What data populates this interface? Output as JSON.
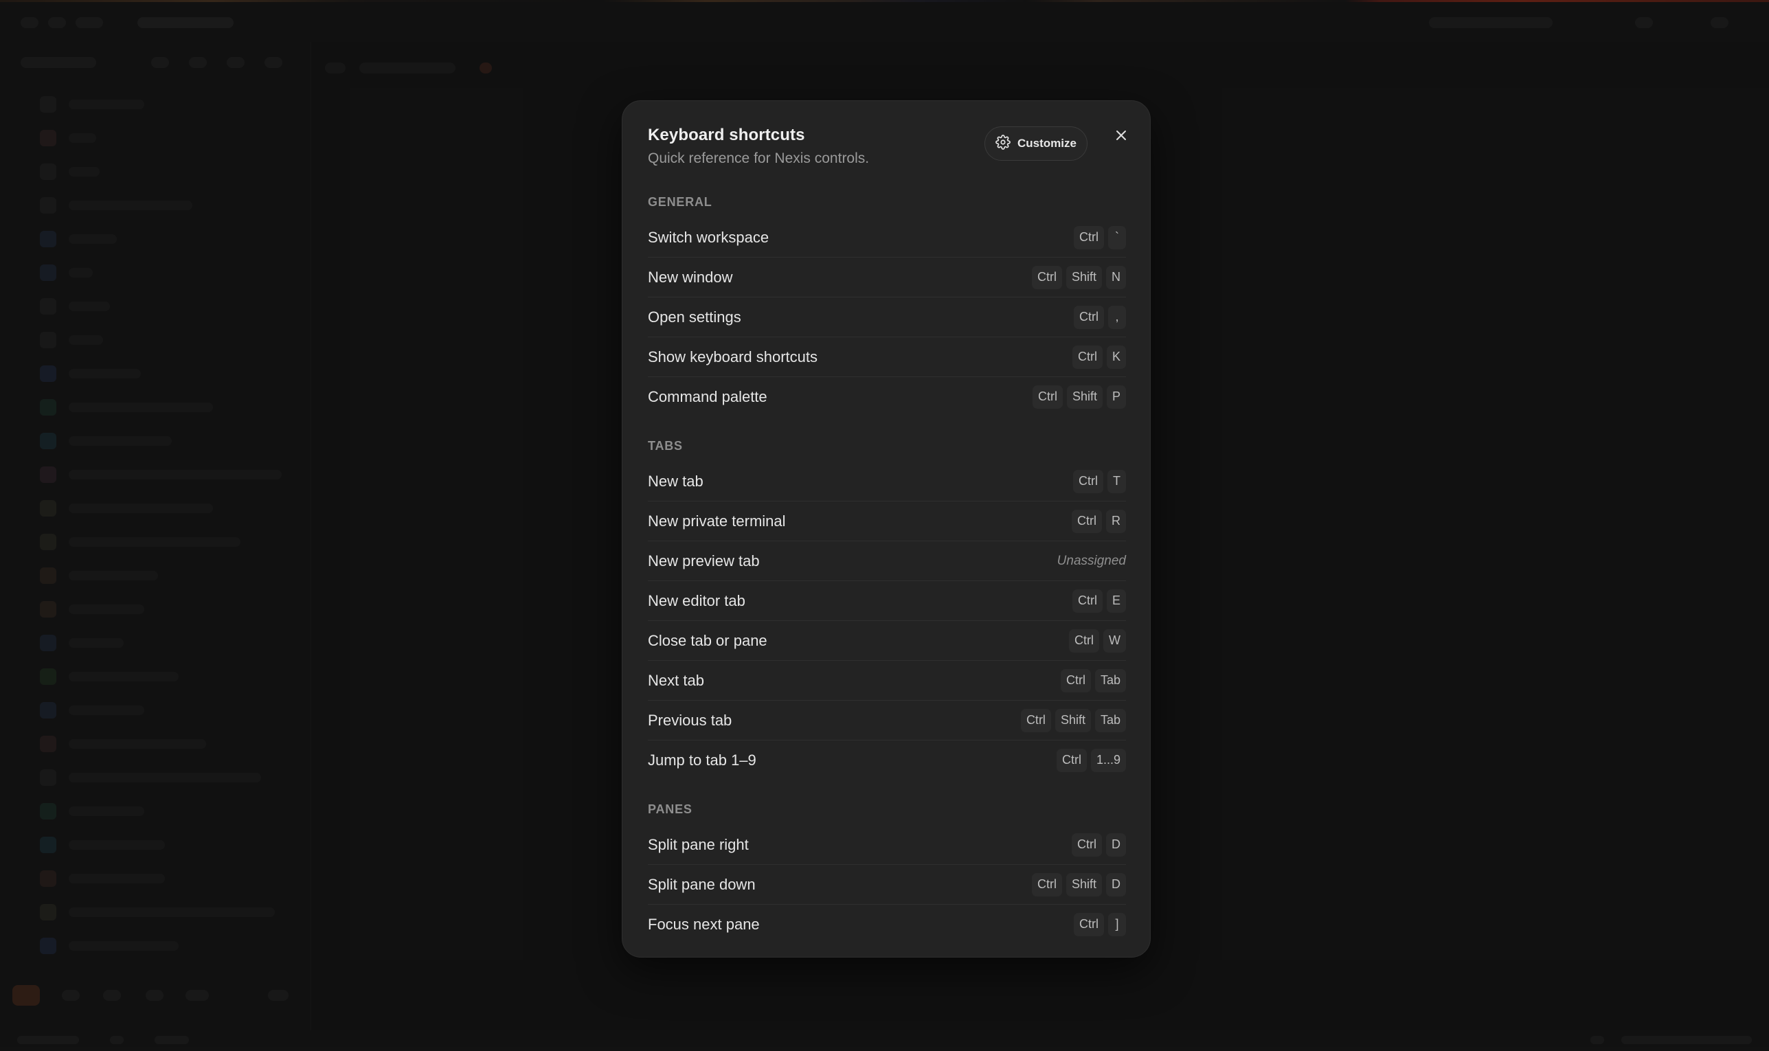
{
  "modal": {
    "title": "Keyboard shortcuts",
    "subtitle": "Quick reference for Nexis controls.",
    "customize_label": "Customize",
    "sections": [
      {
        "heading": "GENERAL",
        "rows": [
          {
            "label": "Switch workspace",
            "keys": [
              "Ctrl",
              "`"
            ]
          },
          {
            "label": "New window",
            "keys": [
              "Ctrl",
              "Shift",
              "N"
            ]
          },
          {
            "label": "Open settings",
            "keys": [
              "Ctrl",
              ","
            ]
          },
          {
            "label": "Show keyboard shortcuts",
            "keys": [
              "Ctrl",
              "K"
            ]
          },
          {
            "label": "Command palette",
            "keys": [
              "Ctrl",
              "Shift",
              "P"
            ]
          }
        ]
      },
      {
        "heading": "TABS",
        "rows": [
          {
            "label": "New tab",
            "keys": [
              "Ctrl",
              "T"
            ]
          },
          {
            "label": "New private terminal",
            "keys": [
              "Ctrl",
              "R"
            ]
          },
          {
            "label": "New preview tab",
            "unassigned": "Unassigned"
          },
          {
            "label": "New editor tab",
            "keys": [
              "Ctrl",
              "E"
            ]
          },
          {
            "label": "Close tab or pane",
            "keys": [
              "Ctrl",
              "W"
            ]
          },
          {
            "label": "Next tab",
            "keys": [
              "Ctrl",
              "Tab"
            ]
          },
          {
            "label": "Previous tab",
            "keys": [
              "Ctrl",
              "Shift",
              "Tab"
            ]
          },
          {
            "label": "Jump to tab 1–9",
            "keys": [
              "Ctrl",
              "1...9"
            ]
          }
        ]
      },
      {
        "heading": "PANES",
        "rows": [
          {
            "label": "Split pane right",
            "keys": [
              "Ctrl",
              "D"
            ]
          },
          {
            "label": "Split pane down",
            "keys": [
              "Ctrl",
              "Shift",
              "D"
            ]
          },
          {
            "label": "Focus next pane",
            "keys": [
              "Ctrl",
              "]"
            ]
          }
        ]
      }
    ]
  },
  "icons": {
    "customize": "gear-icon",
    "close": "close-icon"
  },
  "colors": {
    "modal_bg": "#232323",
    "text": "#e6e6e6",
    "muted": "#9a9a9a",
    "key_bg": "#2b2b2b"
  }
}
